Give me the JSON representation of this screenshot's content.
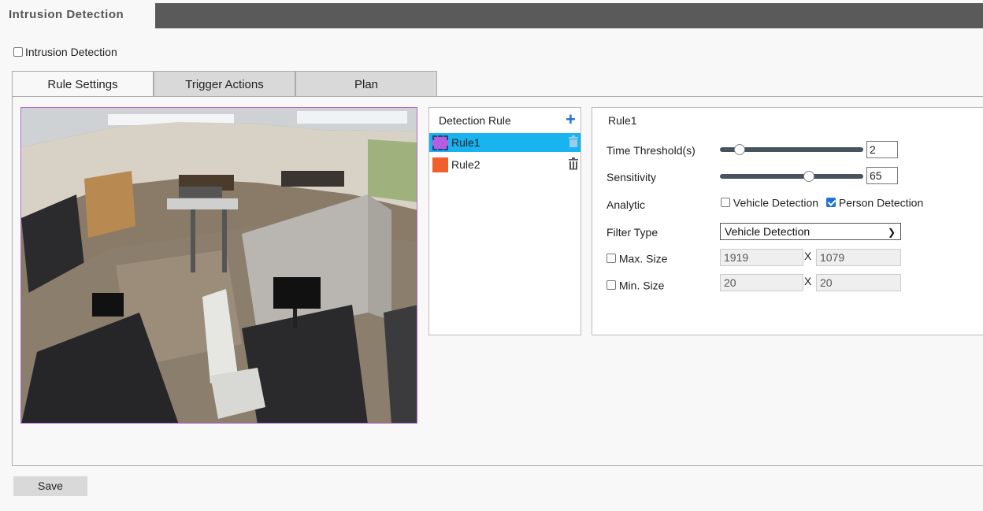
{
  "page": {
    "title": "Intrusion Detection"
  },
  "enable": {
    "label": "Intrusion Detection",
    "checked": false
  },
  "tabs": [
    {
      "label": "Rule Settings",
      "active": true
    },
    {
      "label": "Trigger Actions",
      "active": false
    },
    {
      "label": "Plan",
      "active": false
    }
  ],
  "rules_panel": {
    "header": "Detection Rule",
    "add_icon": "plus-icon",
    "items": [
      {
        "label": "Rule1",
        "color": "#b35de3",
        "selected": true,
        "delete_icon": "trash-icon"
      },
      {
        "label": "Rule2",
        "color": "#f0602b",
        "selected": false,
        "delete_icon": "trash-icon"
      }
    ]
  },
  "settings": {
    "title": "Rule1",
    "time_threshold": {
      "label": "Time Threshold(s)",
      "value": "2"
    },
    "sensitivity": {
      "label": "Sensitivity",
      "value": "65"
    },
    "analytic": {
      "label": "Analytic",
      "options": [
        {
          "label": "Vehicle Detection",
          "checked": false
        },
        {
          "label": "Person Detection",
          "checked": true
        }
      ]
    },
    "filter_type": {
      "label": "Filter Type",
      "value": "Vehicle Detection"
    },
    "max_size": {
      "label": "Max. Size",
      "checked": false,
      "width": "1919",
      "height": "1079",
      "sep": "X"
    },
    "min_size": {
      "label": "Min. Size",
      "checked": false,
      "width": "20",
      "height": "20",
      "sep": "X"
    }
  },
  "buttons": {
    "save": "Save"
  },
  "colors": {
    "accent": "#1e73d8",
    "selected_row": "#19b3f0",
    "slider": "#47535f",
    "topbar": "#5a5a5a"
  }
}
